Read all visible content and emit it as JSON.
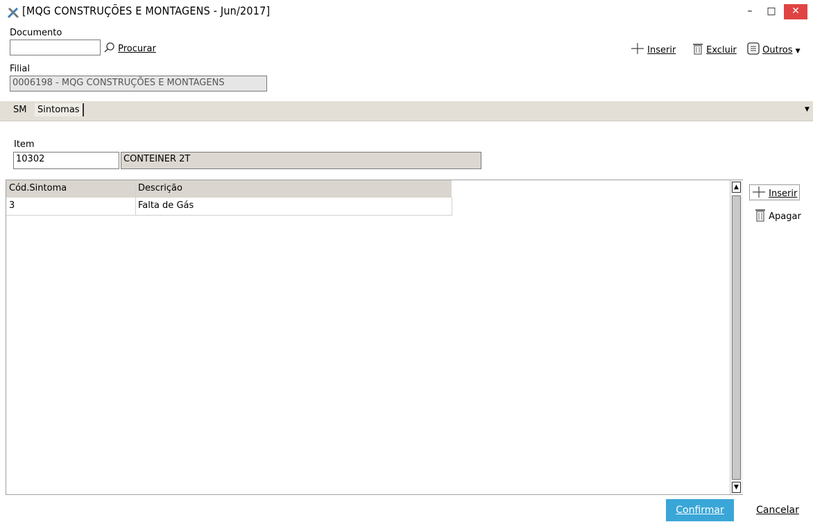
{
  "window": {
    "title": "[MQG CONSTRUÇÕES E MONTAGENS - Jun/2017]",
    "min": "–",
    "max": "□",
    "close": "✕"
  },
  "toolbar": {
    "documento_label": "Documento",
    "documento_value": "",
    "procurar": "Procurar",
    "inserir": "Inserir",
    "excluir": "Excluir",
    "outros": "Outros"
  },
  "filial": {
    "label": "Filial",
    "value": "0006198 - MQG CONSTRUÇÕES E MONTAGENS"
  },
  "tabs": [
    {
      "label": "SM"
    },
    {
      "label": "Sintomas"
    }
  ],
  "item": {
    "label": "Item",
    "code": "10302",
    "description": "CONTEINER 2T"
  },
  "grid": {
    "columns": [
      "Cód.Sintoma",
      "Descrição"
    ],
    "rows": [
      {
        "code": "3",
        "description": "Falta de Gás"
      }
    ]
  },
  "grid_actions": {
    "inserir": "Inserir",
    "apagar": "Apagar"
  },
  "footer": {
    "confirmar": "Confirmar",
    "cancelar": "Cancelar"
  },
  "colors": {
    "accent": "#3aa6d8",
    "close": "#e04343",
    "tabstrip": "#e3dfd6"
  }
}
